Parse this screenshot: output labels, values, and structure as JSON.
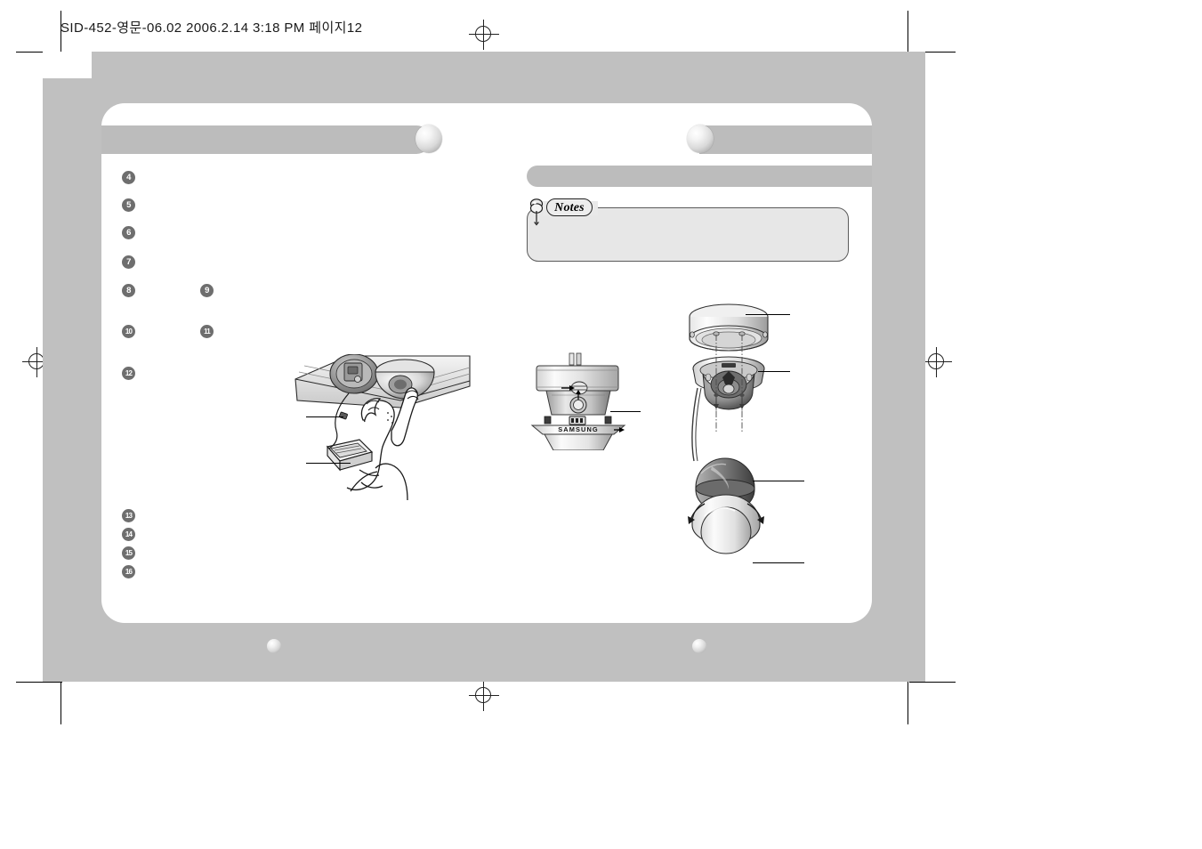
{
  "print_header": {
    "text": "SID-452-영문-06.02  2006.2.14 3:18 PM 페이지12"
  },
  "document": {
    "page_number": "12",
    "brand": "SAMSUNG"
  },
  "sections": {
    "main_bar_title": "",
    "right_bar_title": "",
    "sub_bar_title": ""
  },
  "notes": {
    "label": "Notes",
    "body_text": ""
  },
  "steps": [
    {
      "num": "4",
      "glyph": "4",
      "text": ""
    },
    {
      "num": "5",
      "glyph": "5",
      "text": ""
    },
    {
      "num": "6",
      "glyph": "6",
      "text": ""
    },
    {
      "num": "7",
      "glyph": "7",
      "text": ""
    },
    {
      "num": "8",
      "glyph": "8",
      "text": ""
    },
    {
      "num": "9",
      "glyph": "9",
      "text": ""
    },
    {
      "num": "10",
      "glyph": "10",
      "text": ""
    },
    {
      "num": "11",
      "glyph": "11",
      "text": ""
    },
    {
      "num": "12",
      "glyph": "12",
      "text": ""
    },
    {
      "num": "13",
      "glyph": "13",
      "text": ""
    },
    {
      "num": "14",
      "glyph": "14",
      "text": ""
    },
    {
      "num": "15",
      "glyph": "15",
      "text": ""
    },
    {
      "num": "16",
      "glyph": "16",
      "text": ""
    }
  ],
  "figures": {
    "install_scene": {
      "name": "technician-installing-ceiling-dome-camera",
      "callouts": [
        "",
        ""
      ]
    },
    "camera_front": {
      "name": "dome-camera-front-view",
      "label": "SAMSUNG",
      "callouts": [
        ""
      ]
    },
    "camera_exploded": {
      "name": "dome-camera-exploded-assembly",
      "callouts": [
        "",
        "",
        "",
        ""
      ]
    }
  },
  "colors": {
    "plate_grey": "#c0c0c0",
    "bar_grey": "#bcbcbc",
    "bullet_grey": "#6e6e6e",
    "notes_fill": "#e7e7e7",
    "page_white": "#ffffff"
  }
}
